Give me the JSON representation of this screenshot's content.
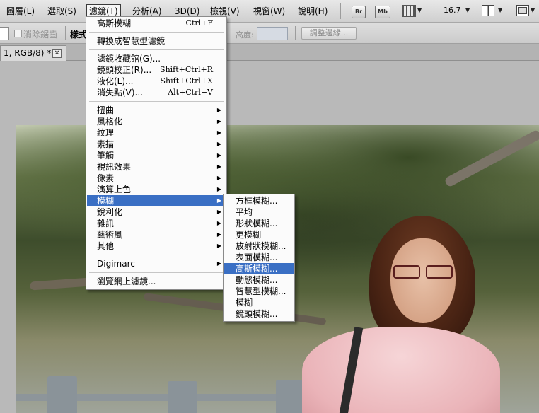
{
  "menubar": {
    "items": [
      {
        "label": "圖層(L)"
      },
      {
        "label": "選取(S)"
      },
      {
        "label": "濾鏡(T)"
      },
      {
        "label": "分析(A)"
      },
      {
        "label": "3D(D)"
      },
      {
        "label": "檢視(V)"
      },
      {
        "label": "視窗(W)"
      },
      {
        "label": "說明(H)"
      }
    ],
    "br_label": "Br",
    "mb_label": "Mb",
    "zoom": "16.7"
  },
  "options": {
    "antialias_label": "消除鋸齒",
    "style_label": "樣式",
    "height_label": "高度:",
    "refine_edge_label": "調整邊緣..."
  },
  "document": {
    "tab_label": "1, RGB/8) *",
    "close_glyph": "×"
  },
  "filter_menu": {
    "items": [
      {
        "label": "高斯模糊",
        "shortcut": "Ctrl+F"
      },
      {
        "label": "轉換成智慧型濾鏡"
      },
      {
        "label": "濾鏡收藏館(G)..."
      },
      {
        "label": "鏡頭校正(R)...",
        "shortcut": "Shift+Ctrl+R"
      },
      {
        "label": "液化(L)...",
        "shortcut": "Shift+Ctrl+X"
      },
      {
        "label": "消失點(V)...",
        "shortcut": "Alt+Ctrl+V"
      },
      {
        "label": "扭曲"
      },
      {
        "label": "風格化"
      },
      {
        "label": "紋理"
      },
      {
        "label": "素描"
      },
      {
        "label": "筆觸"
      },
      {
        "label": "視訊效果"
      },
      {
        "label": "像素"
      },
      {
        "label": "演算上色"
      },
      {
        "label": "模糊"
      },
      {
        "label": "銳利化"
      },
      {
        "label": "雜訊"
      },
      {
        "label": "藝術風"
      },
      {
        "label": "其他"
      },
      {
        "label": "Digimarc"
      },
      {
        "label": "瀏覽網上濾鏡..."
      }
    ]
  },
  "blur_submenu": {
    "items": [
      {
        "label": "方框模糊..."
      },
      {
        "label": "平均"
      },
      {
        "label": "形狀模糊..."
      },
      {
        "label": "更模糊"
      },
      {
        "label": "放射狀模糊..."
      },
      {
        "label": "表面模糊..."
      },
      {
        "label": "高斯模糊..."
      },
      {
        "label": "動態模糊..."
      },
      {
        "label": "智慧型模糊..."
      },
      {
        "label": "模糊"
      },
      {
        "label": "鏡頭模糊..."
      }
    ]
  },
  "icons": {
    "submenu_arrow": "▶",
    "dropdown_arrow": "▼"
  }
}
